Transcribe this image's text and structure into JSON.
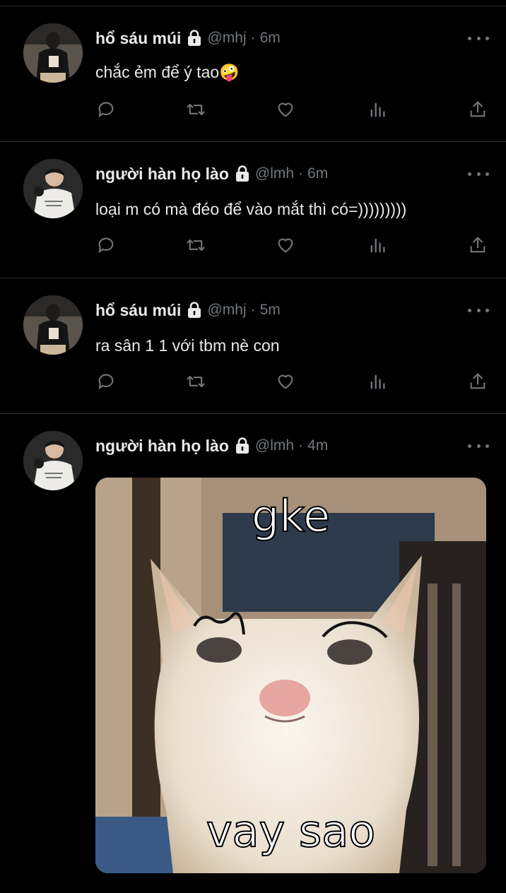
{
  "tweets": [
    {
      "name": "hổ sáu múi",
      "handle": "@mhj",
      "dot": "·",
      "time": "6m",
      "text": "chắc ẻm để ý tao🤪"
    },
    {
      "name": "người hàn họ lào",
      "handle": "@lmh",
      "dot": "·",
      "time": "6m",
      "text": "loại m có mà đéo để vào mắt thì có=)))))))))"
    },
    {
      "name": "hổ sáu múi",
      "handle": "@mhj",
      "dot": "·",
      "time": "5m",
      "text": "ra sân 1 1 với tbm nè con"
    },
    {
      "name": "người hàn họ lào",
      "handle": "@lmh",
      "dot": "·",
      "time": "4m",
      "media": {
        "caption_top": "gke",
        "caption_bottom": "vay sao"
      }
    }
  ],
  "icons": [
    "reply-icon",
    "retweet-icon",
    "like-icon",
    "views-icon",
    "share-icon",
    "lock-icon",
    "more-icon"
  ],
  "colors": {
    "background": "#000000",
    "text": "#e7e9ea",
    "secondary": "#71767b",
    "divider": "#2f3336"
  }
}
